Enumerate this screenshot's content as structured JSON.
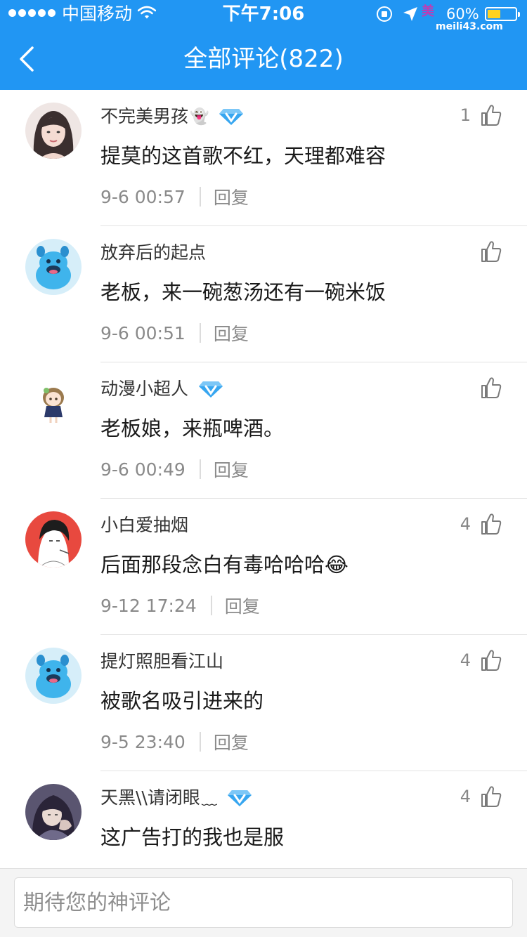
{
  "status_bar": {
    "carrier": "中国移动",
    "time": "下午7:06",
    "battery": "60%",
    "watermark_logo": "美",
    "watermark_text": "meili43.com"
  },
  "nav": {
    "title": "全部评论(822)"
  },
  "comments": [
    {
      "user": "不完美男孩",
      "suffix": "👻",
      "vip": true,
      "likes": "1",
      "text": "提莫的这首歌不红，天理都难容",
      "time": "9-6 00:57",
      "reply": "回复"
    },
    {
      "user": "放弃后的起点",
      "suffix": "",
      "vip": false,
      "likes": "",
      "text": "老板，来一碗葱汤还有一碗米饭",
      "time": "9-6 00:51",
      "reply": "回复"
    },
    {
      "user": "动漫小超人",
      "suffix": "",
      "vip": true,
      "likes": "",
      "text": "老板娘，来瓶啤酒。",
      "time": "9-6 00:49",
      "reply": "回复"
    },
    {
      "user": "小白爱抽烟",
      "suffix": "",
      "vip": false,
      "likes": "4",
      "text": "后面那段念白有毒哈哈哈😂",
      "time": "9-12 17:24",
      "reply": "回复"
    },
    {
      "user": "提灯照胆看江山",
      "suffix": "",
      "vip": false,
      "likes": "4",
      "text": "被歌名吸引进来的",
      "time": "9-5 23:40",
      "reply": "回复"
    },
    {
      "user": "天黑\\\\请闭眼",
      "suffix": "﹏",
      "vip": true,
      "likes": "4",
      "text": "这广告打的我也是服",
      "time": "",
      "reply": ""
    }
  ],
  "input": {
    "placeholder": "期待您的神评论"
  },
  "colors": {
    "header": "#2196f3",
    "vip": "#37a6f0",
    "battery": "#ffd21f"
  },
  "icons": [
    "back-chevron-icon",
    "thumbs-up-icon",
    "vip-diamond-icon",
    "wifi-icon",
    "location-arrow-icon",
    "orientation-lock-icon",
    "battery-icon"
  ]
}
